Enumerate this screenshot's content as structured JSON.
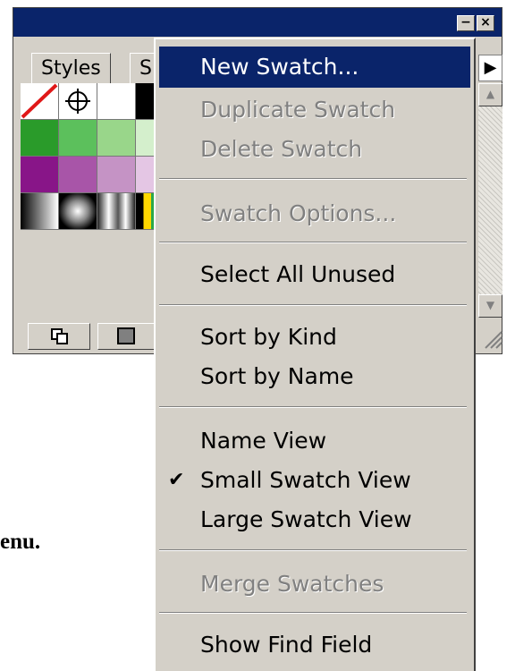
{
  "window": {
    "minimize_glyph": "−",
    "close_glyph": "×",
    "tabs": [
      "Styles",
      "S"
    ],
    "flyout_glyph": "▶"
  },
  "swatches": [
    [
      "none",
      "registration",
      "#ffffff",
      "#000000"
    ],
    [
      "#2a9b2a",
      "#5cc05c",
      "#99d68a",
      "#d4efcc"
    ],
    [
      "#881588",
      "#a855a8",
      "#c593c5",
      "#e4c6e4"
    ],
    [
      "gradient-linear",
      "gradient-radial",
      "gradient-chrome",
      "gradient-rainbow"
    ]
  ],
  "page_text": "enu.",
  "menu": {
    "items": [
      {
        "label": "New Swatch...",
        "state": "highlighted"
      },
      {
        "label": "Duplicate Swatch",
        "state": "disabled"
      },
      {
        "label": "Delete Swatch",
        "state": "disabled"
      },
      {
        "label": "Swatch Options...",
        "state": "disabled"
      },
      {
        "label": "Select All Unused",
        "state": "enabled"
      },
      {
        "label": "Sort by Kind",
        "state": "enabled"
      },
      {
        "label": "Sort by Name",
        "state": "enabled"
      },
      {
        "label": "Name View",
        "state": "enabled"
      },
      {
        "label": "Small Swatch View",
        "state": "checked",
        "check_glyph": "✔"
      },
      {
        "label": "Large Swatch View",
        "state": "enabled"
      },
      {
        "label": "Merge Swatches",
        "state": "disabled"
      },
      {
        "label": "Show Find Field",
        "state": "enabled"
      }
    ]
  },
  "colors": {
    "titlebar": "#0a246a",
    "highlight": "#0a246a",
    "face": "#d4d0c8",
    "disabled_text": "#808080"
  }
}
